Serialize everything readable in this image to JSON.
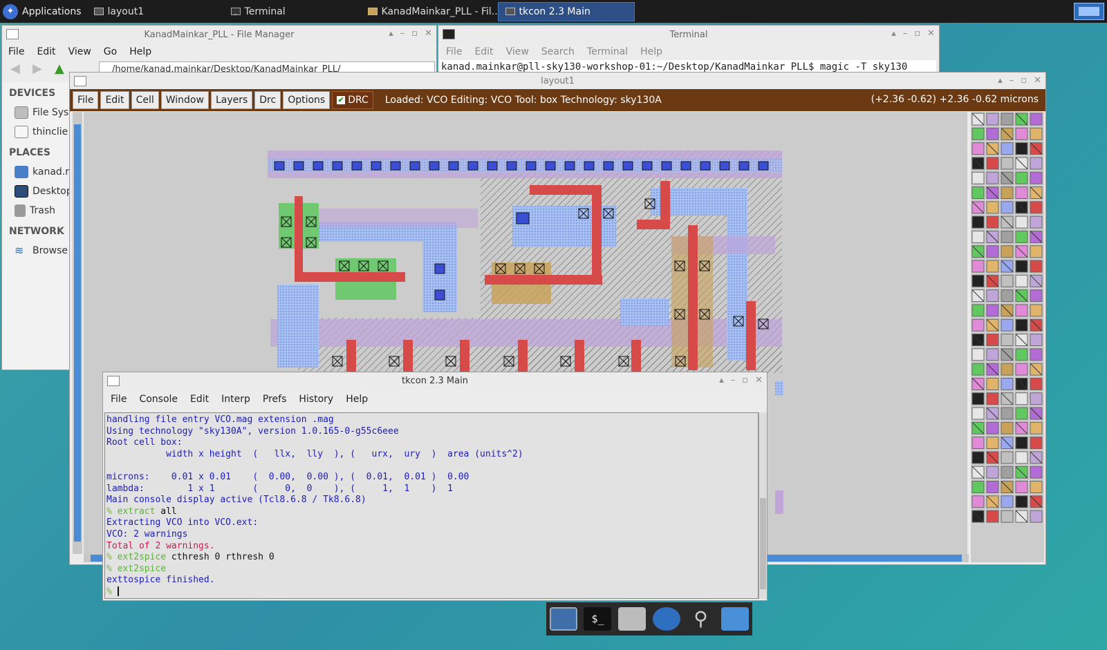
{
  "taskbar": {
    "applications_label": "Applications",
    "tasks": [
      {
        "label": "layout1",
        "icon": "window-icon",
        "active": false
      },
      {
        "label": "Terminal",
        "icon": "terminal-icon",
        "active": false
      },
      {
        "label": "KanadMainkar_PLL - Fil...",
        "icon": "folder-icon",
        "active": false
      },
      {
        "label": "tkcon 2.3 Main",
        "icon": "window-icon",
        "active": true
      }
    ]
  },
  "file_manager": {
    "title": "KanadMainkar_PLL - File Manager",
    "menu": [
      "File",
      "Edit",
      "View",
      "Go",
      "Help"
    ],
    "path": "/home/kanad.mainkar/Desktop/KanadMainkar_PLL/",
    "sections": [
      {
        "header": "DEVICES",
        "items": [
          "File Sys",
          "thinclie"
        ]
      },
      {
        "header": "PLACES",
        "items": [
          "kanad.r",
          "Desktop",
          "Trash"
        ]
      },
      {
        "header": "NETWORK",
        "items": [
          "Browse"
        ]
      }
    ]
  },
  "terminal": {
    "title": "Terminal",
    "menu": [
      "File",
      "Edit",
      "View",
      "Search",
      "Terminal",
      "Help"
    ],
    "line": "kanad.mainkar@pll-sky130-workshop-01:~/Desktop/KanadMainkar_PLL$ magic -T sky130"
  },
  "layout": {
    "title": "layout1",
    "menu": [
      "File",
      "Edit",
      "Cell",
      "Window",
      "Layers",
      "Drc",
      "Options"
    ],
    "drc_label": "DRC",
    "status": "Loaded: VCO Editing: VCO Tool: box  Technology: sky130A",
    "coords": "(+2.36 -0.62) +2.36 -0.62 microns"
  },
  "tkcon": {
    "title": "tkcon 2.3 Main",
    "menu": [
      "File",
      "Console",
      "Edit",
      "Interp",
      "Prefs",
      "History",
      "Help"
    ],
    "lines": [
      {
        "type": "out",
        "text": "handling file entry VCO.mag extension .mag"
      },
      {
        "type": "out",
        "text": "Using technology \"sky130A\", version 1.0.165-0-g55c6eee"
      },
      {
        "type": "out",
        "text": "Root cell box:"
      },
      {
        "type": "out",
        "text": "           width x height  (   llx,  lly  ), (   urx,  ury  )  area (units^2)"
      },
      {
        "type": "out",
        "text": ""
      },
      {
        "type": "out",
        "text": "microns:    0.01 x 0.01    (  0.00,  0.00 ), (  0.01,  0.01 )  0.00"
      },
      {
        "type": "out",
        "text": "lambda:        1 x 1       (     0,  0    ), (     1,  1    )  1"
      },
      {
        "type": "out",
        "text": "Main console display active (Tcl8.6.8 / Tk8.6.8)"
      },
      {
        "type": "cmd",
        "prompt": "% ",
        "cmd": "extract",
        "args": " all"
      },
      {
        "type": "out",
        "text": "Extracting VCO into VCO.ext:"
      },
      {
        "type": "out",
        "text": "VCO: 2 warnings"
      },
      {
        "type": "err",
        "text": "Total of 2 warnings."
      },
      {
        "type": "cmd",
        "prompt": "% ",
        "cmd": "ext2spice",
        "args": " cthresh 0 rthresh 0"
      },
      {
        "type": "cmd",
        "prompt": "% ",
        "cmd": "ext2spice",
        "args": ""
      },
      {
        "type": "out",
        "text": "exttospice finished."
      },
      {
        "type": "prompt",
        "prompt": "% "
      }
    ]
  },
  "colors": {
    "taskbar_bg": "#1c1c1c",
    "magic_menu_bg": "#6b3a12",
    "metal1": "#9aa8f0",
    "poly": "#d64a4a",
    "diff": "#5fc85f",
    "nwell": "#bfa5d8",
    "console_text": "#1c1cb8",
    "console_error": "#cc1a55",
    "console_cmd": "#5ab236"
  },
  "dock": [
    "display-icon",
    "terminal-icon",
    "home-folder-icon",
    "web-browser-icon",
    "search-icon",
    "folder-icon"
  ]
}
